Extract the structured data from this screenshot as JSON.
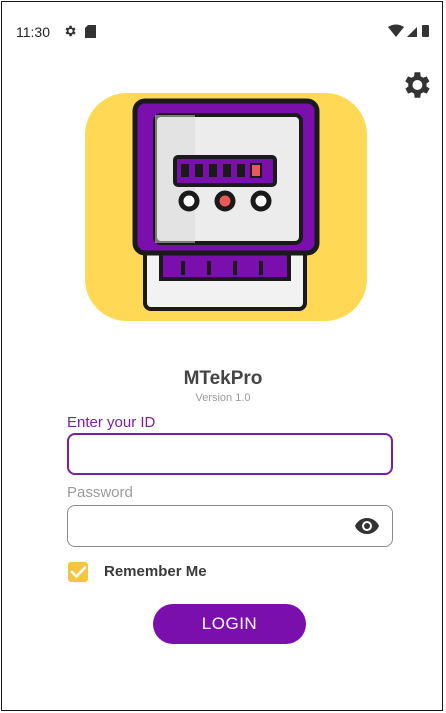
{
  "status_bar": {
    "time": "11:30",
    "icons": [
      "gear-icon",
      "sd-card-icon",
      "wifi-icon",
      "signal-icon",
      "battery-icon"
    ]
  },
  "header": {
    "settings_icon": "gear-icon"
  },
  "app": {
    "name": "MTekPro",
    "version": "Version 1.0",
    "logo_icon": "electric-meter-icon"
  },
  "form": {
    "id_label": "Enter your ID",
    "id_value": "",
    "password_label": "Password",
    "password_value": "",
    "password_toggle_icon": "eye-icon",
    "remember_label": "Remember Me",
    "remember_checked": true,
    "login_label": "LOGIN"
  },
  "colors": {
    "primary": "#7a0fae",
    "logo_background": "#ffd955",
    "checkbox": "#f5c542"
  }
}
